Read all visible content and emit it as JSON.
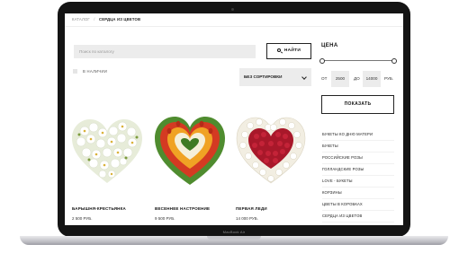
{
  "device": {
    "brand_label": "MacBook Air"
  },
  "breadcrumb": {
    "root": "КАТАЛОГ",
    "sep": "/",
    "current": "СЕРДЦА ИЗ ЦВЕТОВ"
  },
  "search": {
    "placeholder": "Поиск по каталогу",
    "button_label": "НАЙТИ"
  },
  "filters": {
    "in_stock_label": "В НАЛИЧИИ",
    "sort_label": "БЕЗ СОРТИРОВКИ",
    "price_title": "ЦЕНА",
    "from_label": "ОТ",
    "from_value": "2500",
    "to_label": "ДО",
    "to_value": "14000",
    "currency": "РУБ.",
    "apply_label": "ПОКАЗАТЬ"
  },
  "products": [
    {
      "name": "БАРЫШНЯ-КРЕСТЬЯНКА",
      "price": "2 500 РУБ."
    },
    {
      "name": "ВЕСЕННЕЕ НАСТРОЕНИЕ",
      "price": "9 500 РУБ."
    },
    {
      "name": "ПЕРВАЯ ЛЕДИ",
      "price": "14 000 РУБ."
    }
  ],
  "categories": [
    "БУКЕТЫ КО ДНЮ МАТЕРИ",
    "БУКЕТЫ",
    "РОССИЙСКИЕ РОЗЫ",
    "ГОЛЛАНДСКИЕ РОЗЫ",
    "LOVE - БУКЕТЫ",
    "КОРЗИНЫ",
    "ЦВЕТЫ В КОРОБКАХ",
    "СЕРДЦА ИЗ ЦВЕТОВ"
  ],
  "colors": {
    "bezel": "#141414",
    "field_bg": "#ececec",
    "text": "#111111"
  }
}
